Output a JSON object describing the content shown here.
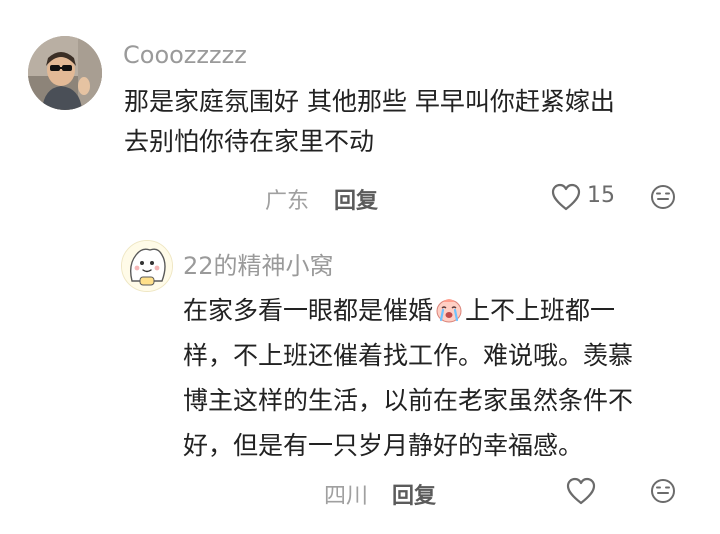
{
  "comment": {
    "username": "Cooozzzzz",
    "text_lines": [
      "那是家庭氛围好 其他那些 早早叫你赶紧嫁出",
      "去别怕你待在家里不动"
    ],
    "location": "广东",
    "reply_label": "回复",
    "like_count": "15",
    "icons": [
      "avatar-photo",
      "heart-icon",
      "emoji-icon"
    ]
  },
  "reply": {
    "username": "22的精神小窝",
    "line1_before": "在家多看一眼都是催婚",
    "line1_emoji": "crying-face-emoji",
    "line1_after": "上不上班都一",
    "text_lines": [
      "样，不上班还催着找工作。难说哦。羡慕",
      "博主这样的生活，以前在老家虽然条件不",
      "好，但是有一只岁月静好的幸福感。"
    ],
    "location": "四川",
    "reply_label": "回复",
    "icons": [
      "avatar-cartoon",
      "heart-icon",
      "emoji-icon"
    ]
  },
  "colors": {
    "username": "#9a9a9a",
    "text": "#222222",
    "location": "#a0a0a0",
    "reply": "#5b5b5b",
    "icon": "#6b6b6b"
  }
}
